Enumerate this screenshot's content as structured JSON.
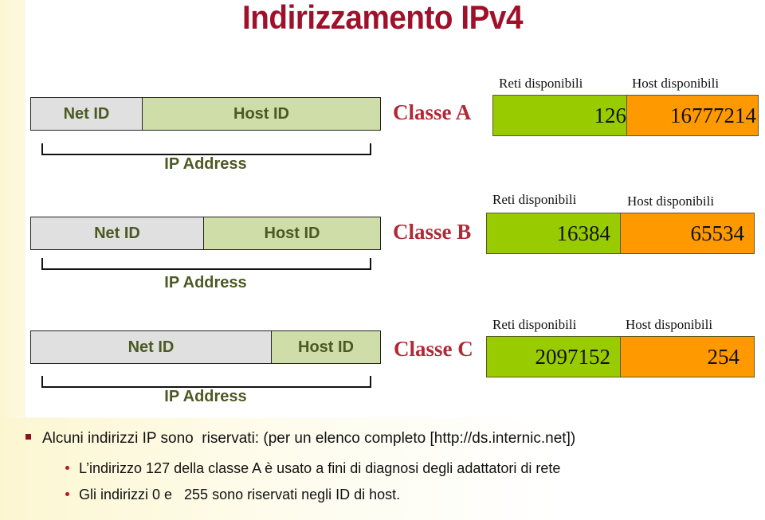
{
  "title": "Indirizzamento IPv4",
  "labels": {
    "net_id": "Net ID",
    "host_id": "Host ID",
    "ip_address": "IP Address",
    "reti_disponibili": "Reti disponibili",
    "host_disponibili": "Host disponibili"
  },
  "classes": [
    {
      "name": "Classe A",
      "reti": "126",
      "host": "16777214"
    },
    {
      "name": "Classe B",
      "reti": "16384",
      "host": "65534"
    },
    {
      "name": "Classe C",
      "reti": "2097152",
      "host": "254"
    }
  ],
  "colors": {
    "title": "#a0102a",
    "classe_label": "#b02a36",
    "net_id_fill": "#e0e0e0",
    "host_id_fill": "#cfdda9",
    "id_text": "#4b5a23",
    "reti_fill": "#99cc00",
    "host_fill": "#ff9900"
  },
  "notes": {
    "main": "Alcuni indirizzi IP sono  riservati: (per un elenco completo [http://ds.internic.net])",
    "sub": [
      "L’indirizzo 127 della classe A è usato a fini di diagnosi degli adattatori di rete",
      "Gli indirizzi 0 e   255 sono riservati negli ID di host."
    ]
  }
}
